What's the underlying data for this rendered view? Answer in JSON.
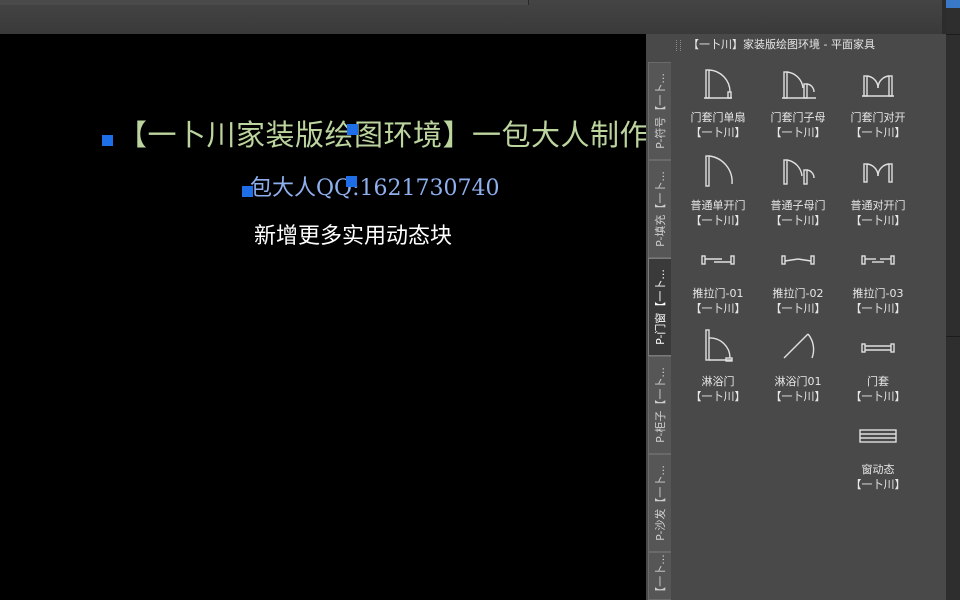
{
  "canvas": {
    "line1": "【一卜川家装版绘图环境】一包大人制作",
    "line2": "包大人QQ:1621730740",
    "line3": "新增更多实用动态块"
  },
  "palette": {
    "title": "【一卜川】家装版绘图环境 - 平面家具",
    "tabs": [
      {
        "label": "P-符号【一卜..."
      },
      {
        "label": "P-填充【一卜..."
      },
      {
        "label": "P-门窗【一卜..."
      },
      {
        "label": "P-柜子【一卜..."
      },
      {
        "label": "P-沙发【一卜..."
      },
      {
        "label": "【一卜..."
      }
    ],
    "items": [
      {
        "name": "门套门单扇",
        "src": "【一卜川】"
      },
      {
        "name": "门套门子母",
        "src": "【一卜川】"
      },
      {
        "name": "门套门对开",
        "src": "【一卜川】"
      },
      {
        "name": "普通单开门",
        "src": "【一卜川】"
      },
      {
        "name": "普通子母门",
        "src": "【一卜川】"
      },
      {
        "name": "普通对开门",
        "src": "【一卜川】"
      },
      {
        "name": "推拉门-01",
        "src": "【一卜川】"
      },
      {
        "name": "推拉门-02",
        "src": "【一卜川】"
      },
      {
        "name": "推拉门-03",
        "src": "【一卜川】"
      },
      {
        "name": "淋浴门",
        "src": "【一卜川】"
      },
      {
        "name": "淋浴门01",
        "src": "【一卜川】"
      },
      {
        "name": "门套",
        "src": "【一卜川】"
      },
      {
        "name": "窗动态",
        "src": "【一卜川】"
      }
    ]
  }
}
